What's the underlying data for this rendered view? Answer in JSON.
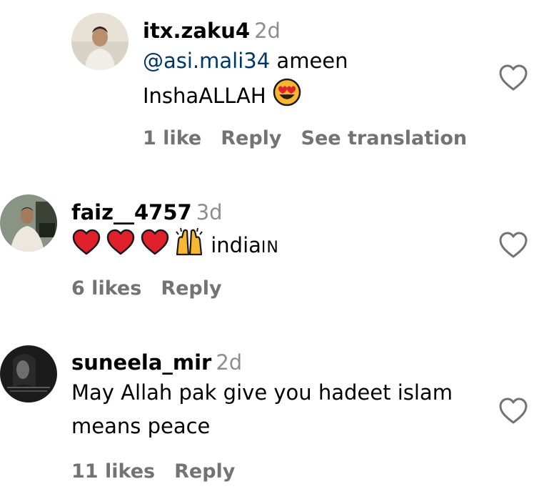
{
  "comments": [
    {
      "username": "itx.zaku4",
      "time": "2d",
      "mention": "@asi.mali34",
      "text_after_mention": "ameen",
      "line2": "InshaALLAH",
      "line2_emoji": "heart-eyes-emoji",
      "likes": "1 like",
      "reply": "Reply",
      "translate": "See translation"
    },
    {
      "username": "faiz__4757",
      "time": "3d",
      "emojis": [
        "red-heart-emoji",
        "red-heart-emoji",
        "red-heart-emoji",
        "raising-hands-emoji"
      ],
      "text": "india",
      "text_suffix": "IN",
      "likes": "6 likes",
      "reply": "Reply"
    },
    {
      "username": "suneela_mir",
      "time": "2d",
      "line1": "May Allah pak give you hadeet islam",
      "line2": "means peace",
      "likes": "11 likes",
      "reply": "Reply"
    }
  ],
  "icons": {
    "like": "heart-outline-icon"
  },
  "colors": {
    "secondary_text": "#737373",
    "timestamp": "#8e8e8e",
    "mention": "#00376b",
    "heart_emoji": "#e0202b"
  }
}
